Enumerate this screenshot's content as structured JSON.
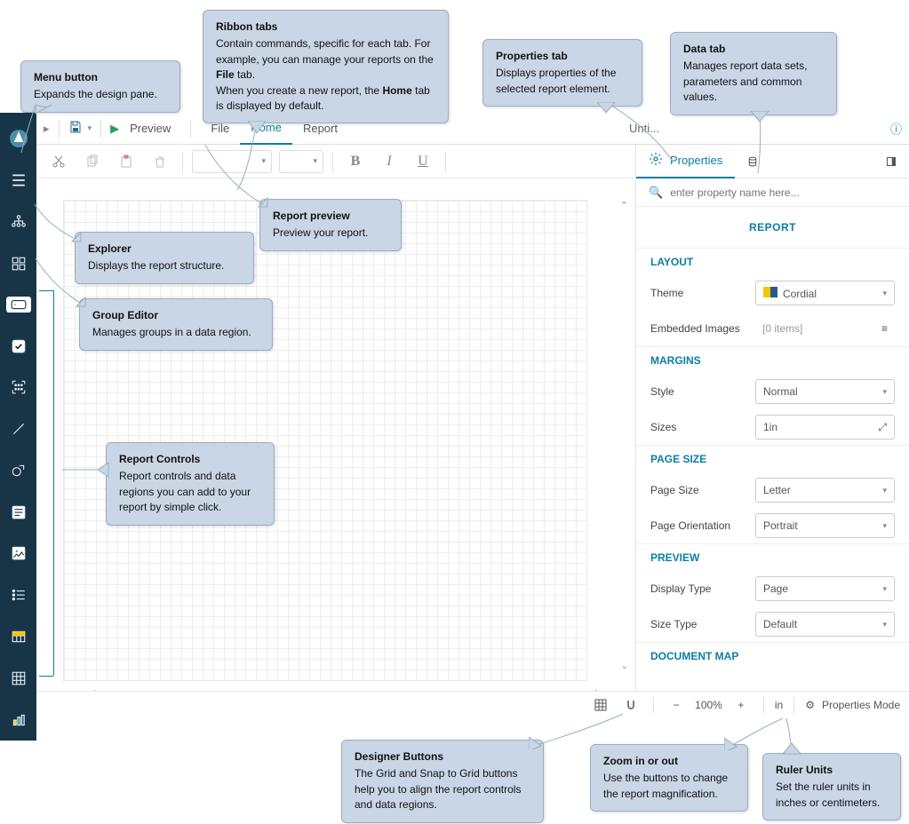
{
  "ribbon": {
    "preview": "Preview",
    "file": "File",
    "home": "Home",
    "report": "Report",
    "filename": "Unti..."
  },
  "properties_tab_label": "Properties",
  "props": {
    "search_placeholder": "enter property name here...",
    "panel_title": "REPORT",
    "sections": {
      "layout": "LAYOUT",
      "margins": "MARGINS",
      "pagesize": "PAGE SIZE",
      "preview": "PREVIEW",
      "docmap": "DOCUMENT MAP"
    },
    "layout": {
      "theme_label": "Theme",
      "theme_value": "Cordial",
      "images_label": "Embedded Images",
      "images_value": "[0 items]"
    },
    "margins": {
      "style_label": "Style",
      "style_value": "Normal",
      "sizes_label": "Sizes",
      "sizes_value": "1in"
    },
    "pagesize": {
      "size_label": "Page Size",
      "size_value": "Letter",
      "orient_label": "Page Orientation",
      "orient_value": "Portrait"
    },
    "preview": {
      "disp_label": "Display Type",
      "disp_value": "Page",
      "size_label": "Size Type",
      "size_value": "Default"
    }
  },
  "status": {
    "zoom": "100%",
    "unit": "in",
    "mode": "Properties Mode"
  },
  "callouts": {
    "c1_title": "Menu button",
    "c1_body": "Expands the design pane.",
    "c2_title": "Ribbon tabs",
    "c2_body1": "Contain commands, specific for each tab. For example, you can manage your reports on the ",
    "c2_bold1": "File",
    "c2_body2": " tab.",
    "c2_body3": "When you create a new report, the ",
    "c2_bold2": "Home",
    "c2_body4": " tab is displayed by default.",
    "c3_title": "Properties tab",
    "c3_body": "Displays properties of the selected report element.",
    "c4_title": "Data tab",
    "c4_body": "Manages report data sets, parameters and common values.",
    "c5_title": "Report preview",
    "c5_body": "Preview your report.",
    "c6_title": "Explorer",
    "c6_body": "Displays the report structure.",
    "c7_title": "Group Editor",
    "c7_body": "Manages groups in a data region.",
    "c8_title": "Report Controls",
    "c8_body": "Report controls and data regions you can add to your report by simple click.",
    "c9_title": "Designer Buttons",
    "c9_body": "The Grid and Snap to Grid buttons help you to align the report controls and data regions.",
    "c10_title": "Zoom in or out",
    "c10_body": "Use the buttons to change the report magnification.",
    "c11_title": "Ruler Units",
    "c11_body": "Set the ruler units in inches or centimeters."
  }
}
